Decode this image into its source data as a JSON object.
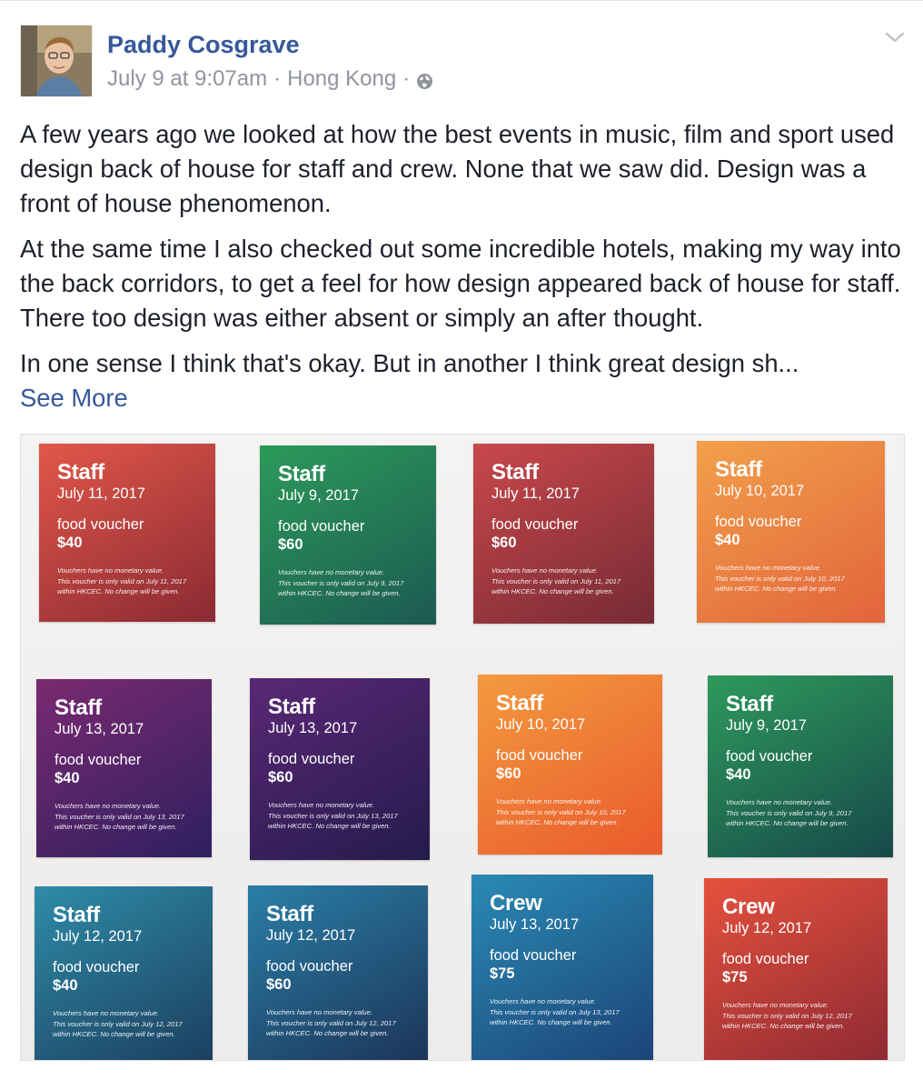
{
  "post": {
    "author": "Paddy Cosgrave",
    "timestamp": "July 9 at 9:07am",
    "location": "Hong Kong",
    "separator": "·",
    "paragraphs": [
      "A few years ago we looked at how the best events in music, film and sport used design back of house for staff and crew. None that we saw did. Design was a front of house phenomenon.",
      "At the same time I also checked out some incredible hotels, making my way into the back corridors, to get a feel for how design appeared back of house for staff. There too design was either absent or simply an after thought.",
      "In one sense I think that's okay. But in another I think great design sh..."
    ],
    "see_more": "See More",
    "icons": {
      "avatar": "profile-photo",
      "privacy": "globe-icon",
      "menu": "chevron-down-icon"
    },
    "colors": {
      "link": "#365899",
      "meta": "#90949c",
      "text": "#1d2129"
    }
  },
  "photo": {
    "kind_label": "food voucher",
    "fine_print_1": "Vouchers have no monetary value.",
    "fine_print_3": "within HKCEC. No change will be given.",
    "vouchers": [
      {
        "role": "Staff",
        "date": "July 11, 2017",
        "amount": "$40",
        "valid": "This voucher is only valid on July 11, 2017",
        "colors": [
          "#e2574a",
          "#8a2a33"
        ]
      },
      {
        "role": "Staff",
        "date": "July 9, 2017",
        "amount": "$60",
        "valid": "This voucher is only valid on July 9, 2017",
        "colors": [
          "#2c9a5a",
          "#1c5a52"
        ]
      },
      {
        "role": "Staff",
        "date": "July 11, 2017",
        "amount": "$60",
        "valid": "This voucher is only valid on July 11, 2017",
        "colors": [
          "#c9484b",
          "#762b35"
        ]
      },
      {
        "role": "Staff",
        "date": "July 10, 2017",
        "amount": "$40",
        "valid": "This voucher is only valid on July 10, 2017",
        "colors": [
          "#f2a04c",
          "#e2643b"
        ]
      },
      {
        "role": "Staff",
        "date": "July 13, 2017",
        "amount": "$40",
        "valid": "This voucher is only valid on July 13, 2017",
        "colors": [
          "#7a2a70",
          "#2e2060"
        ]
      },
      {
        "role": "Staff",
        "date": "July 13, 2017",
        "amount": "$60",
        "valid": "This voucher is only valid on July 13, 2017",
        "colors": [
          "#5a2876",
          "#241b4c"
        ]
      },
      {
        "role": "Staff",
        "date": "July 10, 2017",
        "amount": "$60",
        "valid": "This voucher is only valid on July 10, 2017",
        "colors": [
          "#f39a3f",
          "#ea5a2c"
        ]
      },
      {
        "role": "Staff",
        "date": "July 9, 2017",
        "amount": "$40",
        "valid": "This voucher is only valid on July 9, 2017",
        "colors": [
          "#2e9a5c",
          "#17494a"
        ]
      },
      {
        "role": "Staff",
        "date": "July 12, 2017",
        "amount": "$40",
        "valid": "This voucher is only valid on July 12, 2017",
        "colors": [
          "#2e8ca8",
          "#1c3e5e"
        ]
      },
      {
        "role": "Staff",
        "date": "July 12, 2017",
        "amount": "$60",
        "valid": "This voucher is only valid on July 12, 2017",
        "colors": [
          "#2a7fa6",
          "#1d3358"
        ]
      },
      {
        "role": "Crew",
        "date": "July 13, 2017",
        "amount": "$75",
        "valid": "This voucher is only valid on July 13, 2017",
        "colors": [
          "#2a8ab4",
          "#1c4478"
        ]
      },
      {
        "role": "Crew",
        "date": "July 12, 2017",
        "amount": "$75",
        "valid": "This voucher is only valid on July 12, 2017",
        "colors": [
          "#e5513d",
          "#8e2a33"
        ]
      }
    ]
  }
}
